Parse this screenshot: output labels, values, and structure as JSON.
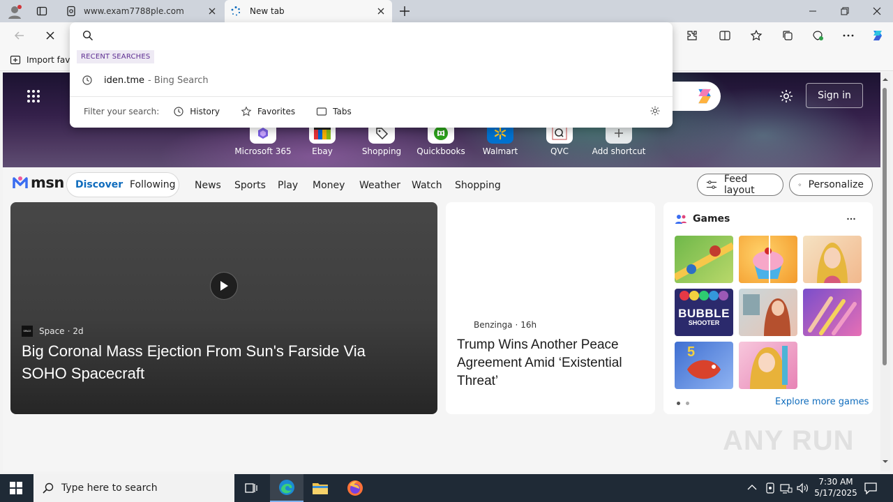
{
  "browser": {
    "tabs": [
      {
        "title": "www.exam7788ple.com",
        "active": false
      },
      {
        "title": "New tab",
        "active": true
      }
    ],
    "favorites_bar": {
      "import_label": "Import favo"
    }
  },
  "omnibox": {
    "recent_label": "RECENT SEARCHES",
    "recent_items": [
      {
        "query": "iden.tme",
        "suffix": "- Bing Search"
      }
    ],
    "filter_label": "Filter your search:",
    "filters": [
      "History",
      "Favorites",
      "Tabs"
    ]
  },
  "newtab": {
    "sign_in_label": "Sign in",
    "shortcuts": [
      {
        "label": "Microsoft 365",
        "icon": "m365-icon"
      },
      {
        "label": "Ebay",
        "icon": "ebay-icon"
      },
      {
        "label": "Shopping",
        "icon": "shopping-tag-icon"
      },
      {
        "label": "Quickbooks",
        "icon": "quickbooks-icon"
      },
      {
        "label": "Walmart",
        "icon": "walmart-icon"
      },
      {
        "label": "QVC",
        "icon": "qvc-icon"
      },
      {
        "label": "Add shortcut",
        "icon": "plus-icon"
      }
    ]
  },
  "msn": {
    "logo_text": "msn",
    "primary_tabs": [
      "Discover",
      "Following"
    ],
    "nav_links": [
      "News",
      "Sports",
      "Play",
      "Money",
      "Weather",
      "Watch",
      "Shopping"
    ],
    "feed_layout_label": "Feed layout",
    "personalize_label": "Personalize"
  },
  "cards": {
    "hero": {
      "source": "Space",
      "source_badge": "SPACE",
      "age": "2d",
      "headline": "Big Coronal Mass Ejection From Sun's Farside Via SOHO Spacecraft"
    },
    "story": {
      "source": "Benzinga",
      "age": "16h",
      "headline": "Trump Wins Another Peace Agreement Amid ‘Existential Threat’"
    },
    "games": {
      "title": "Games",
      "explore_label": "Explore more games",
      "bubble_text_1": "BUBBLE",
      "bubble_text_2": "SHOOTER",
      "level_badge": "5"
    }
  },
  "watermark": "ANY RUN",
  "taskbar": {
    "search_placeholder": "Type here to search",
    "time": "7:30 AM",
    "date": "5/17/2025"
  }
}
